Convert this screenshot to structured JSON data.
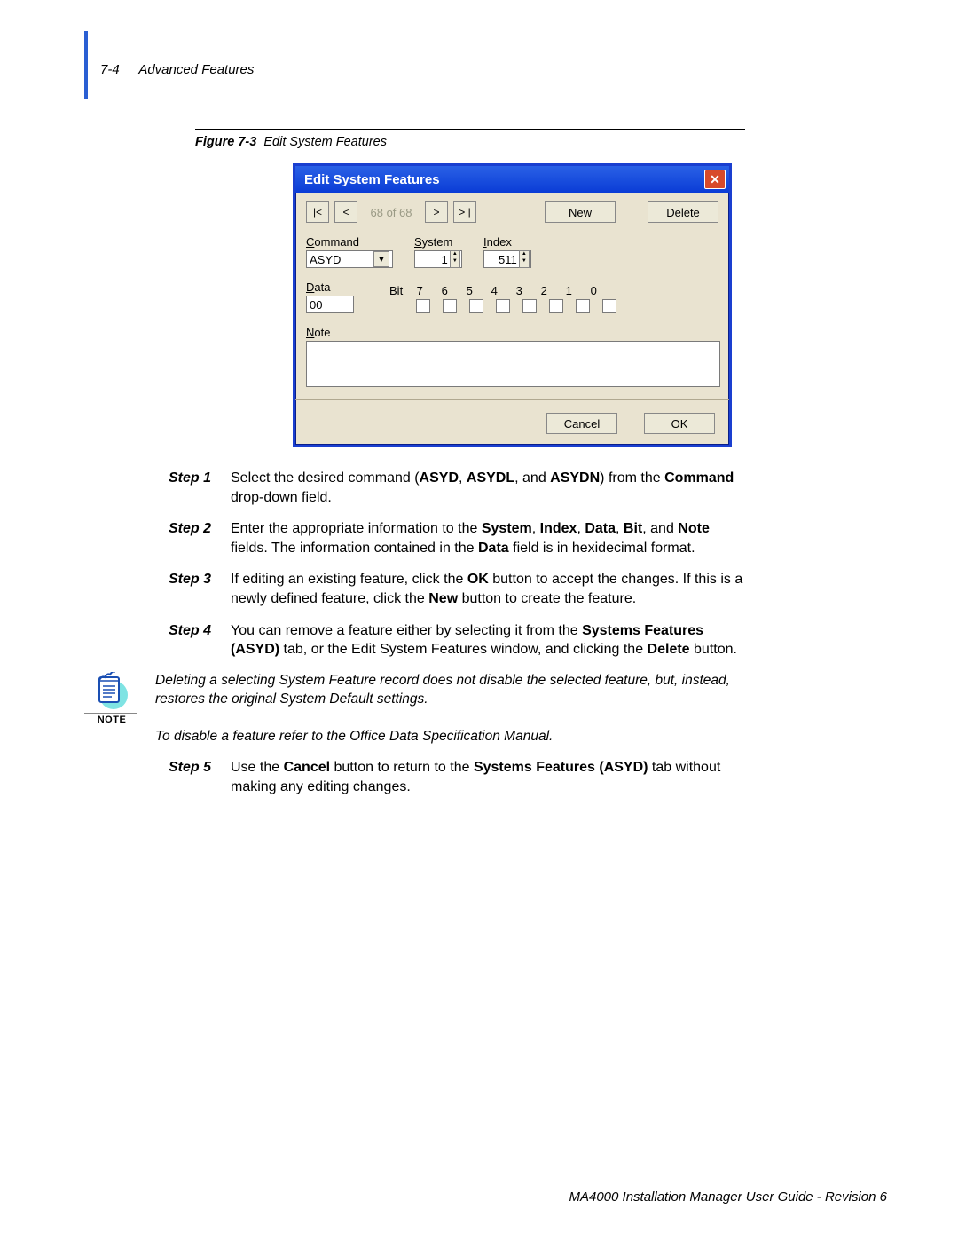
{
  "header": {
    "page_num": "7-4",
    "section": "Advanced Features"
  },
  "figure": {
    "label": "Figure 7-3",
    "title": "Edit System Features"
  },
  "dialog": {
    "title": "Edit System Features",
    "nav": {
      "first": "|<",
      "prev": "<",
      "counter": "68 of 68",
      "next": ">",
      "last": "> |"
    },
    "buttons": {
      "new": "New",
      "delete": "Delete",
      "cancel": "Cancel",
      "ok": "OK"
    },
    "fields": {
      "command_label": "Command",
      "command_value": "ASYD",
      "system_label": "System",
      "system_value": "1",
      "index_label": "Index",
      "index_value": "511",
      "data_label": "Data",
      "data_value": "00",
      "bit_label": "Bit",
      "bits": [
        "7",
        "6",
        "5",
        "4",
        "3",
        "2",
        "1",
        "0"
      ],
      "note_label": "Note"
    }
  },
  "steps": [
    {
      "n": "Step 1",
      "html": "Select the desired command (<b>ASYD</b>, <b>ASYDL</b>, and <b>ASYDN</b>) from the <b>Command</b> drop-down field."
    },
    {
      "n": "Step 2",
      "html": "Enter the appropriate information to the <b>System</b>, <b>Index</b>, <b>Data</b>, <b>Bit</b>, and <b>Note</b> fields. The information contained in the <b>Data</b> field is in hexidecimal format."
    },
    {
      "n": "Step 3",
      "html": "If editing an existing feature, click the <b>OK</b> button to accept the changes. If this is a newly defined feature, click the <b>New</b> button to create the feature."
    },
    {
      "n": "Step 4",
      "html": "You can remove a feature either by selecting it from the <b>Systems Features (ASYD)</b> tab, or the Edit System Features window, and clicking the <b>Delete</b> button."
    },
    {
      "n": "Step 5",
      "html": "Use the <b>Cancel</b> button to return to the <b>Systems Features (ASYD)</b> tab without making any editing changes."
    }
  ],
  "note": {
    "icon_label": "NOTE",
    "line1": "Deleting a selecting System Feature record does not disable the selected feature, but, instead, restores the original System Default settings.",
    "line2": "To disable a feature refer to the Office Data Specification Manual."
  },
  "footer": "MA4000 Installation Manager User Guide - Revision 6"
}
